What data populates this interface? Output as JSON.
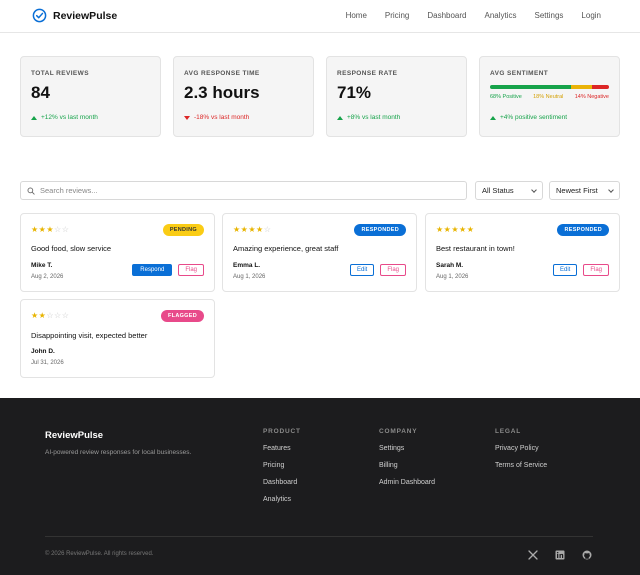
{
  "nav": {
    "brand": "ReviewPulse",
    "links": [
      "Home",
      "Pricing",
      "Dashboard",
      "Analytics",
      "Settings",
      "Login"
    ]
  },
  "stats": {
    "total_reviews": {
      "label": "TOTAL REVIEWS",
      "value": "84",
      "delta": "+12% vs last month"
    },
    "avg_response": {
      "label": "AVG RESPONSE TIME",
      "value": "2.3 hours",
      "delta": "-18% vs last month"
    },
    "response_rate": {
      "label": "RESPONSE RATE",
      "value": "71%",
      "delta": "+8% vs last month"
    },
    "sentiment": {
      "label": "AVG SENTIMENT",
      "positive": "68% Positive",
      "neutral": "18% Neutral",
      "negative": "14% Negative",
      "positive_pct": 68,
      "neutral_pct": 18,
      "negative_pct": 14,
      "delta": "+4% positive sentiment"
    }
  },
  "colors": {
    "positive": "#16a34a",
    "neutral": "#eab308",
    "negative": "#dc2626",
    "accent": "#0a6fd6",
    "flag": "#e84a8a"
  },
  "toolbar": {
    "search_placeholder": "Search reviews...",
    "status_filter": "All Status",
    "sort": "Newest First"
  },
  "reviews": [
    {
      "rating": 3,
      "status": "PENDING",
      "text": "Good food, slow service",
      "author": "Mike T.",
      "date": "Aug 2, 2026",
      "primary_action": "Respond",
      "flag_action": "Flag"
    },
    {
      "rating": 4,
      "status": "RESPONDED",
      "text": "Amazing experience, great staff",
      "author": "Emma L.",
      "date": "Aug 1, 2026",
      "primary_action": "Edit",
      "flag_action": "Flag"
    },
    {
      "rating": 5,
      "status": "RESPONDED",
      "text": "Best restaurant in town!",
      "author": "Sarah M.",
      "date": "Aug 1, 2026",
      "primary_action": "Edit",
      "flag_action": "Flag"
    },
    {
      "rating": 2,
      "status": "FLAGGED",
      "text": "Disappointing visit, expected better",
      "author": "John D.",
      "date": "Jul 31, 2026"
    }
  ],
  "footer": {
    "brand": "ReviewPulse",
    "description": "AI-powered review responses for local businesses.",
    "product": {
      "heading": "PRODUCT",
      "links": [
        "Features",
        "Pricing",
        "Dashboard",
        "Analytics"
      ]
    },
    "company": {
      "heading": "COMPANY",
      "links": [
        "Settings",
        "Billing",
        "Admin Dashboard"
      ]
    },
    "legal": {
      "heading": "LEGAL",
      "links": [
        "Privacy Policy",
        "Terms of Service"
      ]
    },
    "copyright": "© 2026 ReviewPulse. All rights reserved.",
    "social_icons": [
      "x-icon",
      "linkedin-icon",
      "github-icon"
    ]
  }
}
